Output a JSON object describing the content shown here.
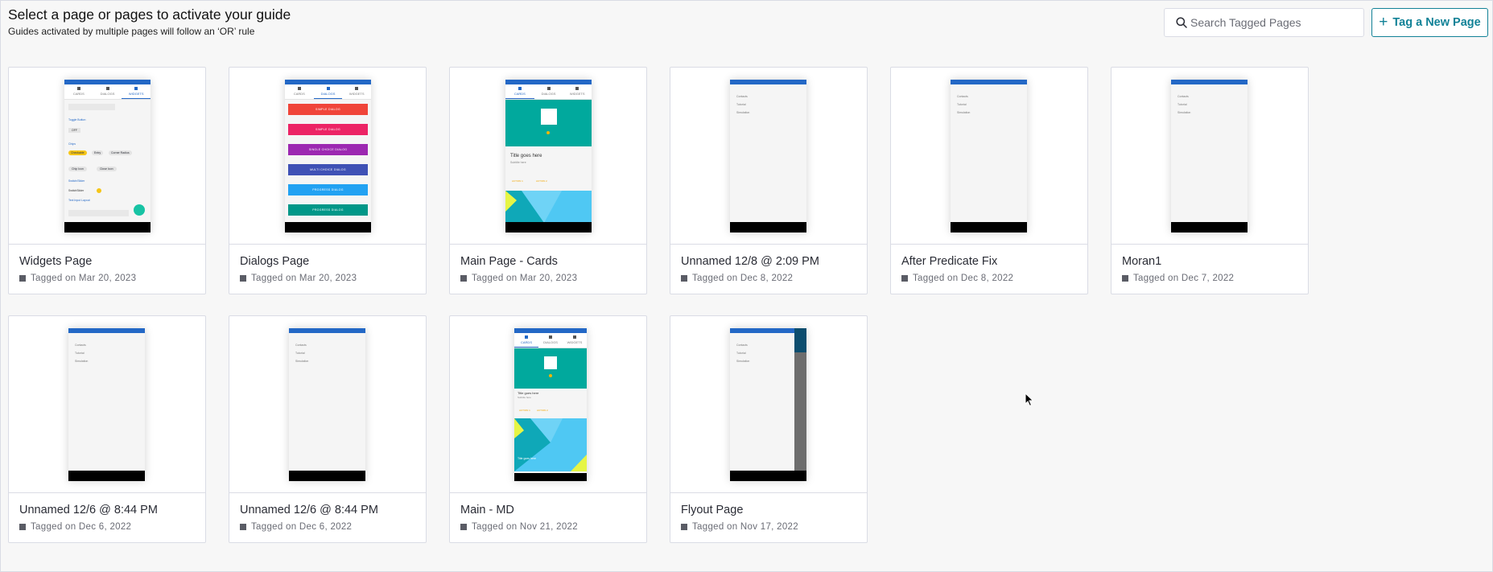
{
  "header": {
    "title": "Select a page or pages to activate your guide",
    "subtitle": "Guides activated by multiple pages will follow an ‘OR’ rule"
  },
  "search": {
    "placeholder": "Search Tagged Pages",
    "icon": "search-icon"
  },
  "tag_button": {
    "label": "Tag a New Page",
    "icon": "plus-icon"
  },
  "colors": {
    "accent": "#128297",
    "phone_topbar": "#2368c6",
    "teal": "#01a99d"
  },
  "pages": [
    {
      "name": "Widgets Page",
      "tagged": "Tagged on Mar 20, 2023",
      "preview": "widgets"
    },
    {
      "name": "Dialogs Page",
      "tagged": "Tagged on Mar 20, 2023",
      "preview": "dialogs"
    },
    {
      "name": "Main Page - Cards",
      "tagged": "Tagged on Mar 20, 2023",
      "preview": "cards"
    },
    {
      "name": "Unnamed 12/8 @ 2:09 PM",
      "tagged": "Tagged on Dec 8, 2022",
      "preview": "blank"
    },
    {
      "name": "After Predicate Fix",
      "tagged": "Tagged on Dec 8, 2022",
      "preview": "blank"
    },
    {
      "name": "Moran1",
      "tagged": "Tagged on Dec 7, 2022",
      "preview": "blank"
    },
    {
      "name": "Unnamed 12/6 @ 8:44 PM",
      "tagged": "Tagged on Dec 6, 2022",
      "preview": "blank"
    },
    {
      "name": "Unnamed 12/6 @ 8:44 PM",
      "tagged": "Tagged on Dec 6, 2022",
      "preview": "blank"
    },
    {
      "name": "Main - MD",
      "tagged": "Tagged on Nov 21, 2022",
      "preview": "md"
    },
    {
      "name": "Flyout Page",
      "tagged": "Tagged on Nov 17, 2022",
      "preview": "flyout"
    }
  ],
  "previews": {
    "tabs": [
      "CARDS",
      "DIALOGS",
      "WIDGETS"
    ],
    "menu": [
      "Contacts",
      "Tutorial",
      "Simulation"
    ],
    "dialogs": [
      "SIMPLE DIALOG",
      "SIMPLE DIALOG",
      "SINGLE CHOICE DIALOG",
      "MULTI CHOICE DIALOG",
      "PROGRESS DIALOG",
      "PROGRESS DIALOG"
    ],
    "card_title": "Title goes here",
    "card_subtitle": "Subtitle here",
    "card_actions": [
      "ACTION 1",
      "ACTION 2"
    ],
    "widgets": [
      "Toggle Button",
      "OFF",
      "Chips",
      "Checkable",
      "Entry",
      "Corner Radius",
      "Chip Icon",
      "Close Icon",
      "Switch/Slider",
      "SwitchSlider",
      "Text Input Layout"
    ]
  }
}
